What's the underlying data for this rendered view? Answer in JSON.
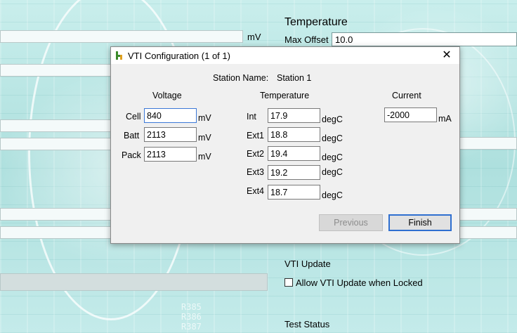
{
  "background": {
    "top_field_unit": "mV",
    "temperature_heading": "Temperature",
    "max_offset_label": "Max Offset",
    "max_offset_value": "10.0",
    "vti_update_heading": "VTI Update",
    "allow_vti_update_label": "Allow VTI Update when Locked",
    "allow_vti_update_checked": false,
    "test_status_heading": "Test Status",
    "pcb_silkscreen": [
      "R385",
      "R386",
      "R387"
    ]
  },
  "dialog": {
    "title": "VTI Configuration (1 of 1)",
    "close_glyph": "✕",
    "station_label": "Station Name:",
    "station_name": "Station 1",
    "voltage": {
      "heading": "Voltage",
      "rows": [
        {
          "label": "Cell",
          "value": "840",
          "unit": "mV"
        },
        {
          "label": "Batt",
          "value": "2113",
          "unit": "mV"
        },
        {
          "label": "Pack",
          "value": "2113",
          "unit": "mV"
        }
      ]
    },
    "temperature": {
      "heading": "Temperature",
      "rows": [
        {
          "label": "Int",
          "value": "17.9",
          "unit": "degC"
        },
        {
          "label": "Ext1",
          "value": "18.8",
          "unit": "degC"
        },
        {
          "label": "Ext2",
          "value": "19.4",
          "unit": "degC"
        },
        {
          "label": "Ext3",
          "value": "19.2",
          "unit": "degC"
        },
        {
          "label": "Ext4",
          "value": "18.7",
          "unit": "degC"
        }
      ]
    },
    "current": {
      "heading": "Current",
      "rows": [
        {
          "label": "",
          "value": "-2000",
          "unit": "mA"
        }
      ]
    },
    "buttons": {
      "previous": "Previous",
      "finish": "Finish"
    }
  }
}
